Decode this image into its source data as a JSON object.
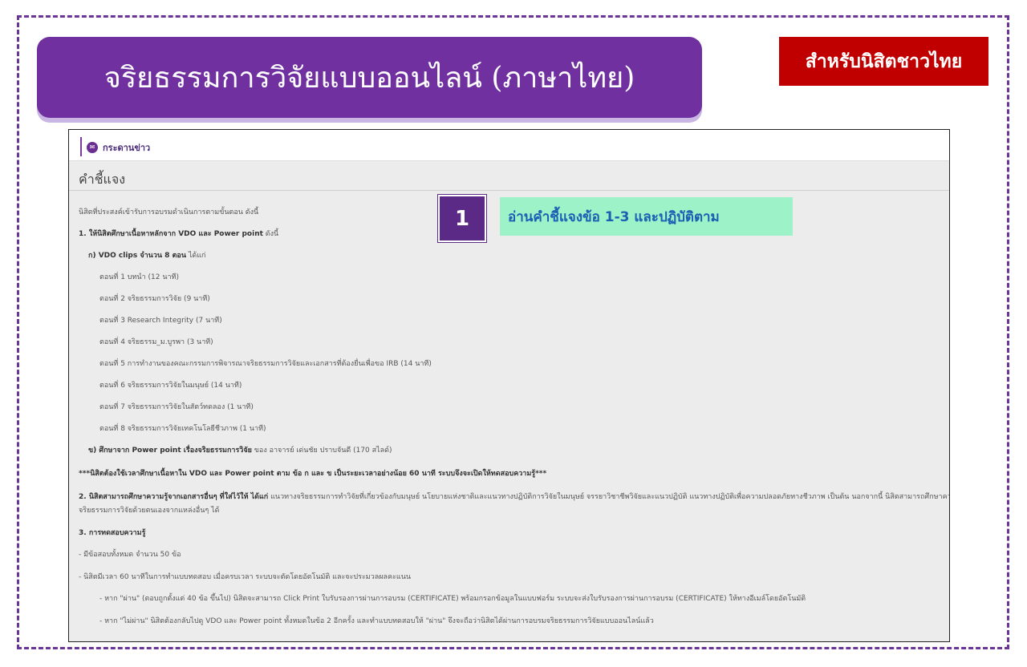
{
  "header": {
    "title": "จริยธรรมการวิจัยแบบออนไลน์ (ภาษาไทย)",
    "badge": "สำหรับนิสิตชาวไทย"
  },
  "callout": {
    "number": "1",
    "text": "อ่านคำชี้แจงข้อ 1-3 และปฏิบัติตาม"
  },
  "page": {
    "forum_label": "กระดานข่าว",
    "section_title": "คำชี้แจง",
    "intro": "นิสิตที่ประสงค์เข้ารับการอบรมดำเนินการตามขั้นตอน ดังนี้",
    "item1_bold": "1. ให้นิสิตศึกษาเนื้อหาหลักจาก VDO และ Power point",
    "item1_tail": " ดังนี้",
    "sub_a_bold": "ก) VDO clips จำนวน 8 ตอน",
    "sub_a_tail": " ได้แก่",
    "episodes": [
      "ตอนที่ 1 บทนำ (12 นาที)",
      "ตอนที่ 2 จริยธรรมการวิจัย (9 นาที)",
      "ตอนที่ 3 Research Integrity (7 นาที)",
      "ตอนที่ 4 จริยธรรม_ม.บูรพา (3 นาที)",
      "ตอนที่ 5 การทำงานของคณะกรรมการพิจารณาจริยธรรมการวิจัยและเอกสารที่ต้องยื่นเพื่อขอ IRB (14 นาที)",
      "ตอนที่ 6 จริยธรรมการวิจัยในมนุษย์ (14 นาที)",
      "ตอนที่ 7 จริยธรรมการวิจัยในสัตว์ทดลอง (1 นาที)",
      "ตอนที่ 8 จริยธรรมการวิจัยเทคโนโลยีชีวภาพ (1 นาที)"
    ],
    "sub_b_bold": "ข) ศึกษาจาก Power point เรื่องจริยธรรมการวิจัย",
    "sub_b_tail": " ของ อาจารย์ เด่นชัย ปราบจันดี (170 สไลด์)",
    "note": "***นิสิตต้องใช้เวลาศึกษาเนื้อหาใน VDO และ Power point ตาม ข้อ ก และ ข เป็นระยะเวลาอย่างน้อย 60 นาที ระบบจึงจะเปิดให้ทดสอบความรู้***",
    "item2_bold": "2. นิสิตสามารถศึกษาความรู้จากเอกสารอื่นๆ ที่ใส่ไว้ให้ ได้แก่",
    "item2_tail": " แนวทางจริยธรรมการทำวิจัยที่เกี่ยวข้องกับมนุษย์ นโยบายแห่งชาติและแนวทางปฏิบัติการวิจัยในมนุษย์ จรรยาวิชาชีพวิจัยและแนวปฏิบัติ แนวทางปฏิบัติเพื่อความปลอดภัยทางชีวภาพ เป็นต้น นอกจากนี้ นิสิตสามารถศึกษาความรู้เกี่ยวกับ",
    "item2_line2": "จริยธรรมการวิจัยด้วยตนเองจากแหล่งอื่นๆ ได้",
    "item3_bold": "3. การทดสอบความรู้",
    "test_total": "- มีข้อสอบทั้งหมด จำนวน 50 ข้อ",
    "test_time": "- นิสิตมีเวลา 60 นาทีในการทำแบบทดสอบ เมื่อครบเวลา ระบบจะตัดโดยอัตโนมัติ และจะประมวลผลคะแนน",
    "pass_text": "- หาก \"ผ่าน\" (ตอบถูกตั้งแต่ 40 ข้อ ขึ้นไป) นิสิตจะสามารถ Click Print ใบรับรองการผ่านการอบรม (CERTIFICATE) พร้อมกรอกข้อมูลในแบบฟอร์ม ระบบจะส่งใบรับรองการผ่านการอบรม (CERTIFICATE) ให้ทางอีเมล์โดยอัตโนมัติ",
    "fail_text": "- หาก \"ไม่ผ่าน\" นิสิตต้องกลับไปดู VDO และ Power point ทั้งหมดในข้อ 2 อีกครั้ง และทำแบบทดสอบให้ \"ผ่าน\" จึงจะถือว่านิสิตได้ผ่านการอบรมจริยธรรมการวิจัยแบบออนไลน์แล้ว"
  }
}
